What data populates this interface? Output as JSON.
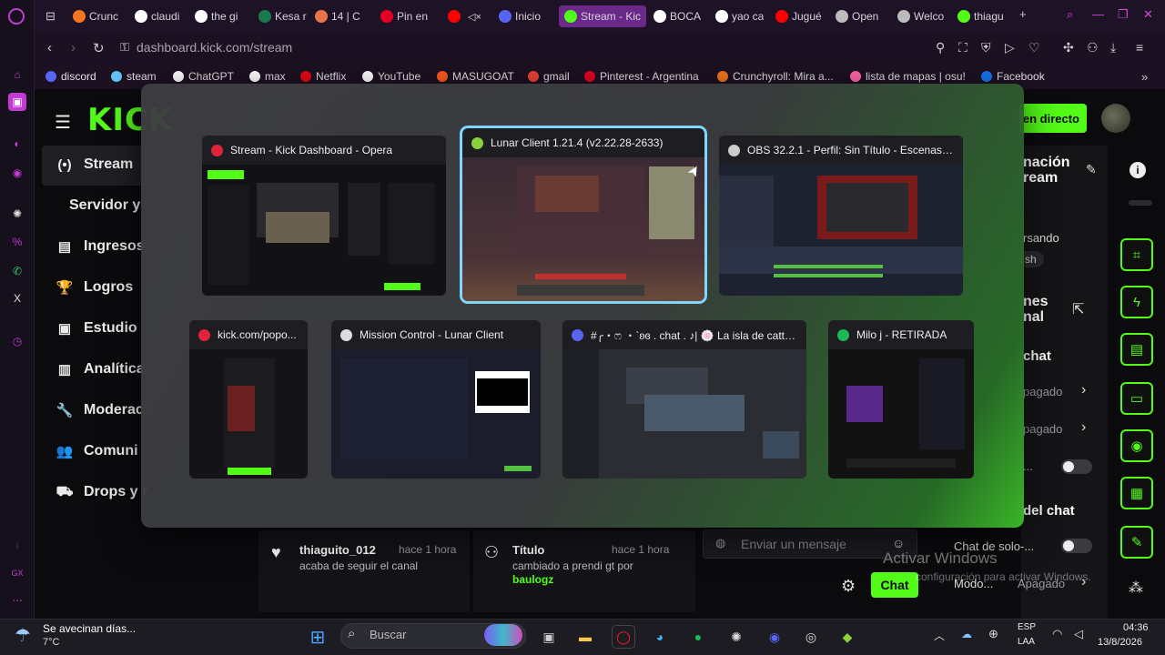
{
  "tabs": [
    {
      "label": "Crunc",
      "color": "#f47521"
    },
    {
      "label": "claudi",
      "color": "#ffffff"
    },
    {
      "label": "the gi",
      "color": "#ffffff"
    },
    {
      "label": "Kesa r",
      "color": "#1a7a4c"
    },
    {
      "label": "14 | C",
      "color": "#e8754a"
    },
    {
      "label": "Pin en",
      "color": "#e60023"
    },
    {
      "label": "",
      "color": "#ff0000"
    },
    {
      "label": "Inicio",
      "color": "#5865f2"
    },
    {
      "label": "Stream - Kic",
      "color": "#53fc18"
    },
    {
      "label": "BOCA",
      "color": "#ffffff"
    },
    {
      "label": "yao ca",
      "color": "#ffffff"
    },
    {
      "label": "Jugué",
      "color": "#ff0000"
    },
    {
      "label": "Open",
      "color": "#bbbbbb"
    },
    {
      "label": "Welco",
      "color": "#bbbbbb"
    },
    {
      "label": "thiagu",
      "color": "#53fc18"
    }
  ],
  "address": {
    "url": "dashboard.kick.com/stream"
  },
  "bookmarks": [
    {
      "label": "discord",
      "color": "#5865f2"
    },
    {
      "label": "steam",
      "color": "#66c0f4"
    },
    {
      "label": "ChatGPT",
      "color": "#ffffff"
    },
    {
      "label": "max",
      "color": "#ffffff"
    },
    {
      "label": "Netflix",
      "color": "#e50914"
    },
    {
      "label": "YouTube",
      "color": "#ffffff"
    },
    {
      "label": "MASUGOAT",
      "color": "#ff5a1f"
    },
    {
      "label": "gmail",
      "color": "#ea4335"
    },
    {
      "label": "Pinterest - Argentina",
      "color": "#e60023"
    },
    {
      "label": "Crunchyroll: Mira a...",
      "color": "#f47521"
    },
    {
      "label": "lista de mapas | osu!",
      "color": "#ff66aa"
    },
    {
      "label": "Facebook",
      "color": "#1877f2"
    }
  ],
  "kick": {
    "logo": "KICK",
    "live_button": "en directo",
    "sidebar": [
      {
        "label": "Stream",
        "icon": "stream-icon",
        "glyph": "(•)"
      },
      {
        "label": "Servidor y",
        "icon": "",
        "glyph": ""
      },
      {
        "label": "Ingresos",
        "icon": "revenue-icon",
        "glyph": "▤"
      },
      {
        "label": "Logros",
        "icon": "trophy-icon",
        "glyph": "🏆"
      },
      {
        "label": "Estudio",
        "icon": "studio-icon",
        "glyph": "▣"
      },
      {
        "label": "Analítica",
        "icon": "analytics-icon",
        "glyph": "▥"
      },
      {
        "label": "Moderac",
        "icon": "wrench-icon",
        "glyph": "🔧"
      },
      {
        "label": "Comuni",
        "icon": "community-icon",
        "glyph": "👥"
      },
      {
        "label": "Drops y r",
        "icon": "drops-icon",
        "glyph": "⛟"
      }
    ],
    "right_panel": {
      "info_title_1": "nación",
      "info_title_2": "ream",
      "conversando": "rsando",
      "tag": "sh",
      "acciones_1": "nes",
      "acciones_2": "nal",
      "chat_heading": "chat",
      "apagado_1": "pagado",
      "apagado_2": "pagado",
      "dots": "...",
      "del_chat": "del chat",
      "chat_solo": "Chat de solo-...",
      "modo": "Modo...",
      "apagado_3": "Apagado"
    },
    "feed": [
      {
        "user": "thiaguito_012",
        "time": "hace 1 hora",
        "text": "acaba de seguir el canal"
      },
      {
        "user": "Título",
        "time": "hace 1 hora",
        "text": "cambiado a prendi gt por",
        "by": "baulogz"
      }
    ],
    "chat_input_placeholder": "Enviar un mensaje",
    "chat_button": "Chat"
  },
  "switcher": {
    "windows": [
      {
        "title": "Stream - Kick Dashboard - Opera",
        "icon_color": "#e0243a",
        "selected": false
      },
      {
        "title": "Lunar Client 1.21.4 (v2.22.28-2633)",
        "icon_color": "#8bd13b",
        "selected": true
      },
      {
        "title": "OBS 32.2.1 - Perfil: Sin Título - Escenas: Sin...",
        "icon_color": "#cccccc",
        "selected": false
      },
      {
        "title": "kick.com/popo...",
        "icon_color": "#e0243a",
        "selected": false
      },
      {
        "title": "Mission Control - Lunar Client",
        "icon_color": "#dddddd",
        "selected": false
      },
      {
        "title": "#╭・ෆ ・`ʚɞ . chat . ♪| 🍥 La isla de cattie -...",
        "icon_color": "#5865f2",
        "selected": false
      },
      {
        "title": "Milo j - RETIRADA",
        "icon_color": "#1db954",
        "selected": false
      }
    ]
  },
  "watermark": {
    "line1": "Activar Windows",
    "line2": "configuración para activar Windows."
  },
  "taskbar": {
    "weather_text": "Se avecinan días...",
    "temp": "7°C",
    "search_placeholder": "Buscar",
    "lang_1": "ESP",
    "lang_2": "LAA",
    "time": "04:36",
    "date": "13/8/2026"
  }
}
